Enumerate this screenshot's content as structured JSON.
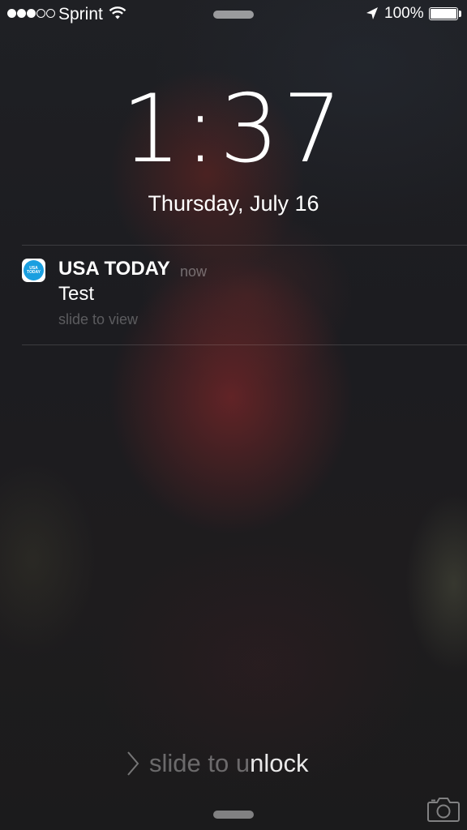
{
  "status_bar": {
    "signal_filled": 3,
    "signal_total": 5,
    "carrier": "Sprint",
    "wifi_icon": "wifi-icon",
    "location_icon": "location-arrow-icon",
    "battery_percent": "100%",
    "battery_level": 1.0
  },
  "lock": {
    "time": "1:37",
    "date": "Thursday, July 16"
  },
  "notification": {
    "app_name": "USA TODAY",
    "app_icon_text": [
      "USA",
      "TODAY"
    ],
    "time": "now",
    "message": "Test",
    "action": "slide to view"
  },
  "unlock": {
    "label_dim": "slide to u",
    "label_bright": "nlock"
  },
  "colors": {
    "usa_today_blue": "#1a9fe0"
  }
}
